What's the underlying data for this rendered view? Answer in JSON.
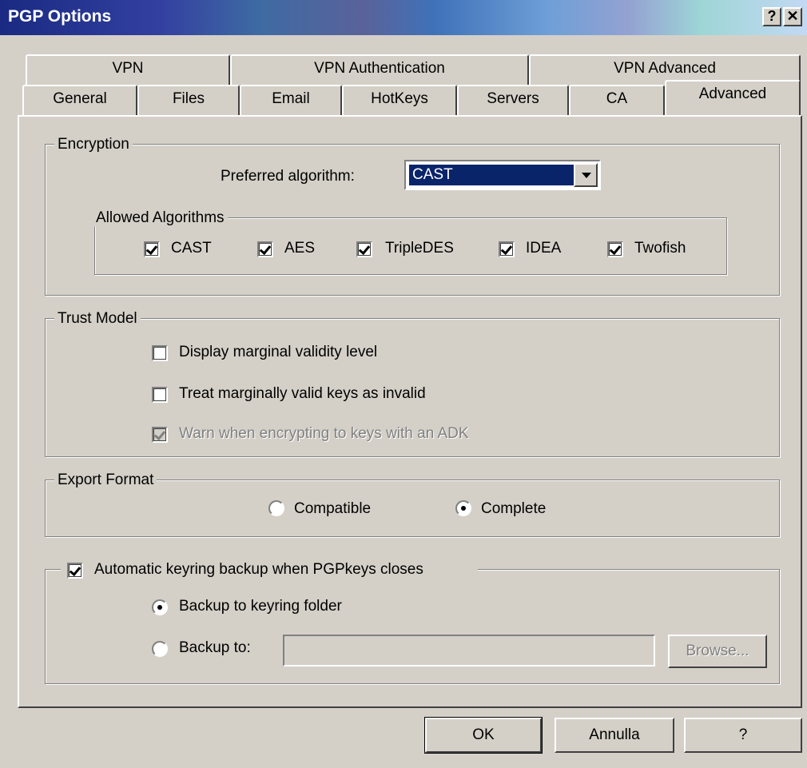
{
  "window": {
    "title": "PGP Options",
    "help_glyph": "?",
    "close_glyph": "✕"
  },
  "tabs": {
    "row_top": [
      "VPN",
      "VPN Authentication",
      "VPN Advanced"
    ],
    "row_bottom": [
      "General",
      "Files",
      "Email",
      "HotKeys",
      "Servers",
      "CA",
      "Advanced"
    ],
    "active": "Advanced"
  },
  "encryption": {
    "legend": "Encryption",
    "preferred_label": "Preferred algorithm:",
    "preferred_value": "CAST",
    "allowed": {
      "legend": "Allowed Algorithms",
      "items": [
        {
          "label": "CAST",
          "checked": true
        },
        {
          "label": "AES",
          "checked": true
        },
        {
          "label": "TripleDES",
          "checked": true
        },
        {
          "label": "IDEA",
          "checked": true
        },
        {
          "label": "Twofish",
          "checked": true
        }
      ]
    }
  },
  "trust": {
    "legend": "Trust Model",
    "display_marginal": "Display marginal validity level",
    "treat_marginal": "Treat marginally valid keys as invalid",
    "warn_adk": "Warn when encrypting to keys with an ADK"
  },
  "export": {
    "legend": "Export Format",
    "compatible": "Compatible",
    "complete": "Complete",
    "selected": "Complete"
  },
  "backup": {
    "auto_label": "Automatic keyring backup when PGPkeys closes",
    "to_folder": "Backup to keyring folder",
    "to_path": "Backup to:",
    "path_value": "",
    "browse": "Browse..."
  },
  "buttons": {
    "ok": "OK",
    "cancel": "Annulla",
    "help": "?"
  }
}
